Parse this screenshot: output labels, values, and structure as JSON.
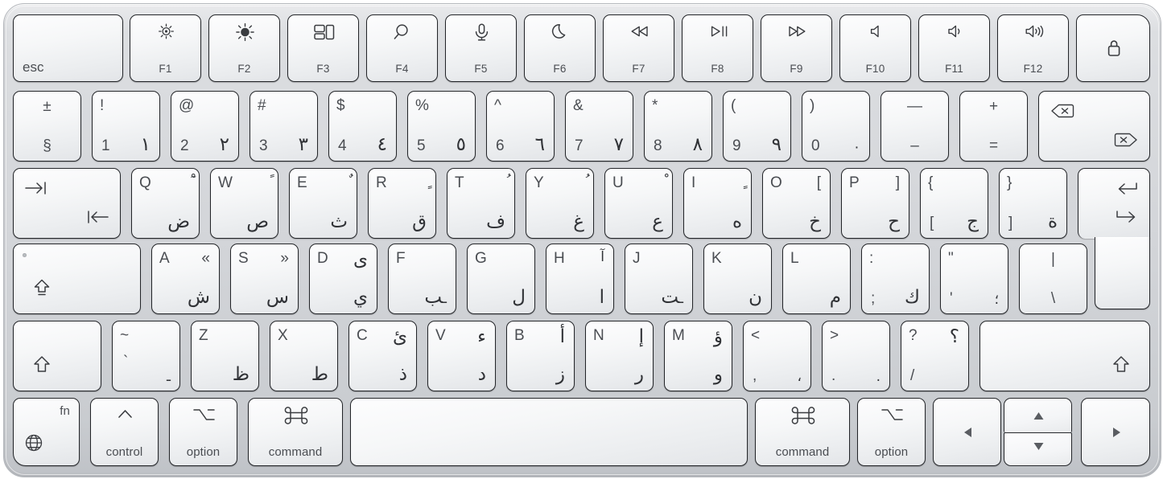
{
  "device": {
    "name": "Apple Magic Keyboard with Touch ID",
    "layout": "Arabic",
    "body_color": "#d3d5d9",
    "key_color": "#f6f7f8",
    "legend_color": "#3b3d41"
  },
  "rows": {
    "function_row": [
      {
        "name": "esc-key",
        "label": "esc"
      },
      {
        "name": "f1-key",
        "fn": "F1",
        "icon": "brightness-down-icon"
      },
      {
        "name": "f2-key",
        "fn": "F2",
        "icon": "brightness-up-icon"
      },
      {
        "name": "f3-key",
        "fn": "F3",
        "icon": "mission-control-icon"
      },
      {
        "name": "f4-key",
        "fn": "F4",
        "icon": "spotlight-search-icon"
      },
      {
        "name": "f5-key",
        "fn": "F5",
        "icon": "dictation-microphone-icon"
      },
      {
        "name": "f6-key",
        "fn": "F6",
        "icon": "do-not-disturb-moon-icon"
      },
      {
        "name": "f7-key",
        "fn": "F7",
        "icon": "rewind-icon"
      },
      {
        "name": "f8-key",
        "fn": "F8",
        "icon": "play-pause-icon"
      },
      {
        "name": "f9-key",
        "fn": "F9",
        "icon": "fast-forward-icon"
      },
      {
        "name": "f10-key",
        "fn": "F10",
        "icon": "volume-mute-icon"
      },
      {
        "name": "f11-key",
        "fn": "F11",
        "icon": "volume-down-icon"
      },
      {
        "name": "f12-key",
        "fn": "F12",
        "icon": "volume-up-icon"
      },
      {
        "name": "touch-id-key",
        "fn": "",
        "icon": "lock-touch-id-icon"
      }
    ],
    "number_row": [
      {
        "name": "key-section",
        "top": "±",
        "bottom": "§",
        "arabic": ""
      },
      {
        "name": "key-1",
        "top": "!",
        "bottom": "1",
        "arabic": "١"
      },
      {
        "name": "key-2",
        "top": "@",
        "bottom": "2",
        "arabic": "٢"
      },
      {
        "name": "key-3",
        "top": "#",
        "bottom": "3",
        "arabic": "٣"
      },
      {
        "name": "key-4",
        "top": "$",
        "bottom": "4",
        "arabic": "٤"
      },
      {
        "name": "key-5",
        "top": "%",
        "bottom": "5",
        "arabic": "٥"
      },
      {
        "name": "key-6",
        "top": "^",
        "bottom": "6",
        "arabic": "٦"
      },
      {
        "name": "key-7",
        "top": "&",
        "bottom": "7",
        "arabic": "٧"
      },
      {
        "name": "key-8",
        "top": "*",
        "bottom": "8",
        "arabic": "٨"
      },
      {
        "name": "key-9",
        "top": "(",
        "bottom": "9",
        "arabic": "٩"
      },
      {
        "name": "key-0",
        "top": ")",
        "bottom": "0",
        "arabic": "٠"
      },
      {
        "name": "key-minus",
        "top": "—",
        "bottom": "–",
        "arabic": ""
      },
      {
        "name": "key-equals",
        "top": "+",
        "bottom": "=",
        "arabic": ""
      },
      {
        "name": "delete-key",
        "top": "",
        "bottom": "",
        "arabic": ""
      }
    ],
    "top_letter_row": [
      {
        "name": "tab-key",
        "latin": "",
        "arabic": "",
        "sym": ""
      },
      {
        "name": "key-q",
        "latin": "Q",
        "arabic": "ض",
        "sym": "ْٓ"
      },
      {
        "name": "key-w",
        "latin": "W",
        "arabic": "ص",
        "sym": "ً"
      },
      {
        "name": "key-e",
        "latin": "E",
        "arabic": "ث",
        "sym": "ٌ"
      },
      {
        "name": "key-r",
        "latin": "R",
        "arabic": "ق",
        "sym": "ٍ"
      },
      {
        "name": "key-t",
        "latin": "T",
        "arabic": "ف",
        "sym": "ُ"
      },
      {
        "name": "key-y",
        "latin": "Y",
        "arabic": "غ",
        "sym": "ُ"
      },
      {
        "name": "key-u",
        "latin": "U",
        "arabic": "ع",
        "sym": "ْ"
      },
      {
        "name": "key-i",
        "latin": "I",
        "arabic": "ه",
        "sym": "ٍ"
      },
      {
        "name": "key-o",
        "latin": "O",
        "arabic": "خ",
        "sym": "["
      },
      {
        "name": "key-p",
        "latin": "P",
        "arabic": "ح",
        "sym": "]"
      },
      {
        "name": "key-bracket-left",
        "latin": "{",
        "arabic": "ج",
        "sym": "["
      },
      {
        "name": "key-bracket-right",
        "latin": "}",
        "arabic": "ة",
        "sym": "]"
      },
      {
        "name": "return-key",
        "latin": "",
        "arabic": "",
        "sym": ""
      }
    ],
    "home_row": [
      {
        "name": "caps-lock-key",
        "latin": "",
        "arabic": "",
        "sym": ""
      },
      {
        "name": "key-a",
        "latin": "A",
        "arabic": "ش",
        "sym": "«"
      },
      {
        "name": "key-s",
        "latin": "S",
        "arabic": "س",
        "sym": "»"
      },
      {
        "name": "key-d",
        "latin": "D",
        "arabic": "ي",
        "sym": "ى"
      },
      {
        "name": "key-f",
        "latin": "F",
        "arabic": "ب",
        "sym": "ـ"
      },
      {
        "name": "key-g",
        "latin": "G",
        "arabic": "ل",
        "sym": ""
      },
      {
        "name": "key-h",
        "latin": "H",
        "arabic": "ا",
        "sym": "آ"
      },
      {
        "name": "key-j",
        "latin": "J",
        "arabic": "ت",
        "sym": "ـ"
      },
      {
        "name": "key-k",
        "latin": "K",
        "arabic": "ن",
        "sym": ""
      },
      {
        "name": "key-l",
        "latin": "L",
        "arabic": "م",
        "sym": ""
      },
      {
        "name": "key-semicolon",
        "latin": ":",
        "arabic": "ك",
        "sym": ";"
      },
      {
        "name": "key-quote",
        "latin": "\"",
        "arabic": "؛",
        "sym": "'"
      },
      {
        "name": "key-backslash",
        "latin": "|",
        "arabic": "",
        "sym": "\\"
      }
    ],
    "bottom_letter_row": [
      {
        "name": "left-shift-key",
        "latin": "",
        "arabic": "",
        "sym": ""
      },
      {
        "name": "key-backtick",
        "latin": "~",
        "arabic": "ـ",
        "sym": "`"
      },
      {
        "name": "key-z",
        "latin": "Z",
        "arabic": "ظ",
        "sym": ""
      },
      {
        "name": "key-x",
        "latin": "X",
        "arabic": "ط",
        "sym": ""
      },
      {
        "name": "key-c",
        "latin": "C",
        "arabic": "ذ",
        "sym": "ئ"
      },
      {
        "name": "key-v",
        "latin": "V",
        "arabic": "د",
        "sym": "ء"
      },
      {
        "name": "key-b",
        "latin": "B",
        "arabic": "ز",
        "sym": "أ"
      },
      {
        "name": "key-n",
        "latin": "N",
        "arabic": "ر",
        "sym": "إ"
      },
      {
        "name": "key-m",
        "latin": "M",
        "arabic": "و",
        "sym": "ؤ"
      },
      {
        "name": "key-comma",
        "latin": "<",
        "arabic": "،",
        "sym": ","
      },
      {
        "name": "key-period",
        "latin": ">",
        "arabic": ".",
        "sym": "."
      },
      {
        "name": "key-slash",
        "latin": "?",
        "arabic": "؟",
        "sym": "/"
      },
      {
        "name": "right-shift-key",
        "latin": "",
        "arabic": "",
        "sym": ""
      }
    ],
    "modifier_row": [
      {
        "name": "fn-key",
        "label": "fn",
        "icon": "globe-icon"
      },
      {
        "name": "left-control-key",
        "label": "control",
        "icon": "control-caret-icon"
      },
      {
        "name": "left-option-key",
        "label": "option",
        "icon": "option-icon"
      },
      {
        "name": "left-command-key",
        "label": "command",
        "icon": "command-icon"
      },
      {
        "name": "space-bar",
        "label": "",
        "icon": ""
      },
      {
        "name": "right-command-key",
        "label": "command",
        "icon": "command-icon"
      },
      {
        "name": "right-option-key",
        "label": "option",
        "icon": "option-icon"
      },
      {
        "name": "arrow-left-key",
        "label": "",
        "icon": "arrow-left-icon"
      },
      {
        "name": "arrow-up-key",
        "label": "",
        "icon": "arrow-up-icon"
      },
      {
        "name": "arrow-down-key",
        "label": "",
        "icon": "arrow-down-icon"
      },
      {
        "name": "arrow-right-key",
        "label": "",
        "icon": "arrow-right-icon"
      }
    ]
  }
}
